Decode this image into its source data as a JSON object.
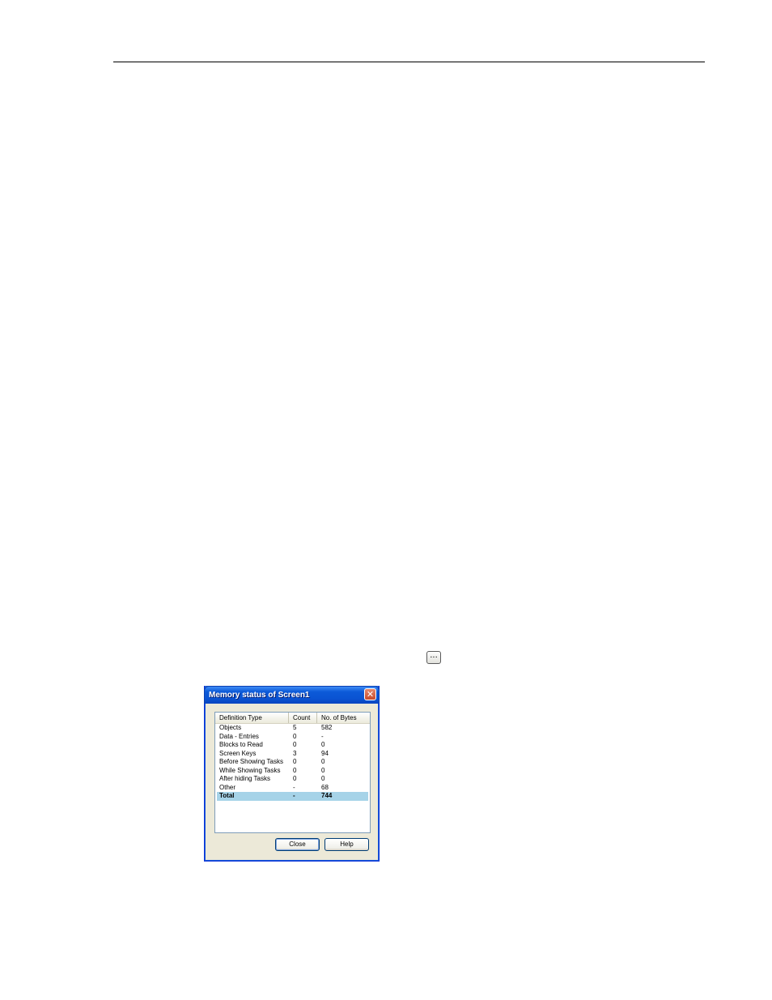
{
  "inline_button": {
    "glyph": "..."
  },
  "dialog": {
    "title": "Memory status of Screen1",
    "close_glyph": "✕",
    "columns": [
      "Definition Type",
      "Count",
      "No. of Bytes"
    ],
    "rows": [
      [
        "Objects",
        "5",
        "582"
      ],
      [
        "Data - Entries",
        "0",
        "-"
      ],
      [
        "Blocks to Read",
        "0",
        "0"
      ],
      [
        "Screen Keys",
        "3",
        "94"
      ],
      [
        "Before Showing Tasks",
        "0",
        "0"
      ],
      [
        "While Showing Tasks",
        "0",
        "0"
      ],
      [
        "After hiding Tasks",
        "0",
        "0"
      ],
      [
        "Other",
        "-",
        "68"
      ],
      [
        "Total",
        "-",
        "744"
      ]
    ],
    "selected_row": "Total",
    "buttons": {
      "close": "Close",
      "help": "Help"
    }
  },
  "colors": {
    "titlebar": "#0a53d2",
    "selection": "#a6d3e8",
    "dialog_face": "#ece9d8"
  }
}
